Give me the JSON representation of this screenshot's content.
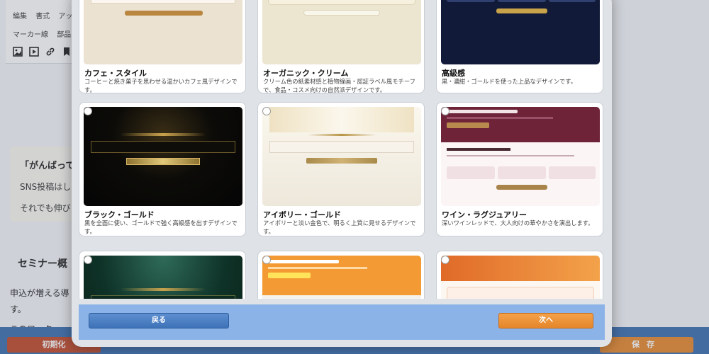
{
  "editor": {
    "toolbar_row1": [
      "編集",
      "書式",
      "アッ"
    ],
    "toolbar_row2": [
      "マーカー線",
      "部品"
    ],
    "toolbar_icons": [
      "image-icon",
      "video-icon",
      "link-icon",
      "bookmark-icon"
    ],
    "card_heading": "「がんばって",
    "card_line1": "SNS投稿はし",
    "card_line2": "それでも伸び",
    "section_heading": "セミナー概",
    "body_line1": "申込が増える導",
    "body_line2": "す。",
    "body_line3": "このワーク",
    "reset_label": "初期化",
    "save_label": "保存"
  },
  "modal": {
    "templates": [
      {
        "title": "カフェ・スタイル",
        "desc": "コーヒーと焼き菓子を思わせる温かいカフェ風デザインです。"
      },
      {
        "title": "オーガニック・クリーム",
        "desc": "クリーム色の紙素材感と植物線画・認証ラベル風モチーフで、食品・コスメ向けの自然派デザインです。"
      },
      {
        "title": "高級感",
        "desc": "黒・濃紺・ゴールドを使った上品なデザインです。"
      },
      {
        "title": "ブラック・ゴールド",
        "desc": "黒を全面に使い、ゴールドで強く高級感を出すデザインです。"
      },
      {
        "title": "アイボリー・ゴールド",
        "desc": "アイボリーと淡い金色で、明るく上質に見せるデザインです。"
      },
      {
        "title": "ワイン・ラグジュアリー",
        "desc": "深いワインレッドで、大人向けの華やかさを演出します。"
      },
      {
        "title": "",
        "desc": ""
      },
      {
        "title": "",
        "desc": ""
      },
      {
        "title": "",
        "desc": ""
      }
    ],
    "back_label": "戻る",
    "next_label": "次へ"
  },
  "colors": {
    "accent_blue": "#3e72b8",
    "accent_orange": "#e5862a",
    "danger_red": "#c24a2a",
    "gold": "#b8913d",
    "wine": "#6e2339"
  }
}
